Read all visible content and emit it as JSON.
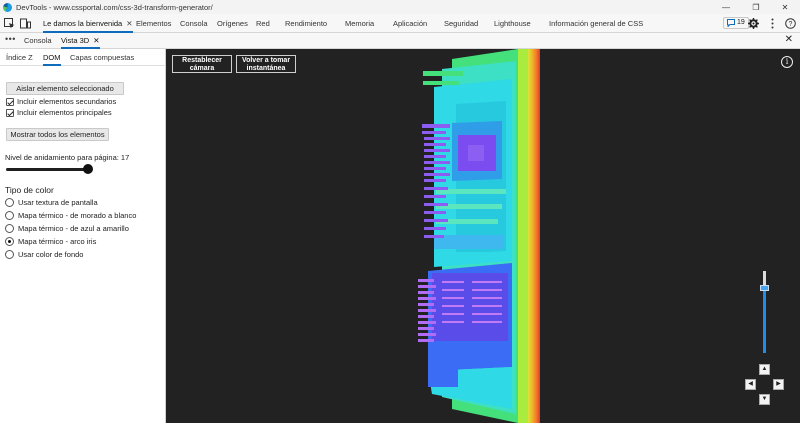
{
  "window": {
    "title": "DevTools - www.cssportal.com/css-3d-transform-generator/"
  },
  "tabs": [
    {
      "label": "Le damos la bienvenida",
      "close": "✕"
    },
    {
      "label": "Elementos"
    },
    {
      "label": "Consola"
    },
    {
      "label": "Orígenes"
    },
    {
      "label": "Red"
    },
    {
      "label": "Rendimiento"
    },
    {
      "label": "Memoria"
    },
    {
      "label": "Aplicación"
    },
    {
      "label": "Seguridad"
    },
    {
      "label": "Lighthouse"
    },
    {
      "label": "Información general de CSS"
    }
  ],
  "issues_count": "19",
  "drawer": {
    "tabs": [
      {
        "label": "Consola"
      },
      {
        "label": "Vista 3D",
        "close": "✕"
      }
    ]
  },
  "panel": {
    "subtabs": [
      "Índice Z",
      "DOM",
      "Capas compuestas"
    ],
    "isolate_button": "Aislar elemento seleccionado",
    "include_children": "Incluir elementos secundarios",
    "include_parents": "Incluir elementos principales",
    "show_all_button": "Mostrar todos los elementos",
    "nesting_label": "Nivel de anidamiento para página: 17",
    "nesting_level": 17,
    "color_type_title": "Tipo de color",
    "color_options": [
      {
        "label": "Usar textura de pantalla",
        "selected": false
      },
      {
        "label": "Mapa térmico - de morado a blanco",
        "selected": false
      },
      {
        "label": "Mapa térmico - de azul a amarillo",
        "selected": false
      },
      {
        "label": "Mapa térmico - arco iris",
        "selected": true
      },
      {
        "label": "Usar color de fondo",
        "selected": false
      }
    ]
  },
  "viewport": {
    "reset_camera_line1": "Restablecer",
    "reset_camera_line2": "cámara",
    "snapshot_line1": "Volver a tomar",
    "snapshot_line2": "instantánea",
    "info": "i",
    "pan_up": "▲",
    "pan_left": "◀",
    "pan_right": "▶",
    "pan_down": "▼"
  },
  "colors": {
    "accent": "#0f6cbd",
    "viewport_bg": "#222222",
    "heat_purple": "#7b4df0",
    "heat_blue": "#3a6cf5",
    "heat_cyan": "#2fd9e6",
    "heat_green": "#3ce08a",
    "heat_yellow": "#d9e63a",
    "heat_orange": "#f08a2a",
    "heat_red": "#e23a2a"
  }
}
